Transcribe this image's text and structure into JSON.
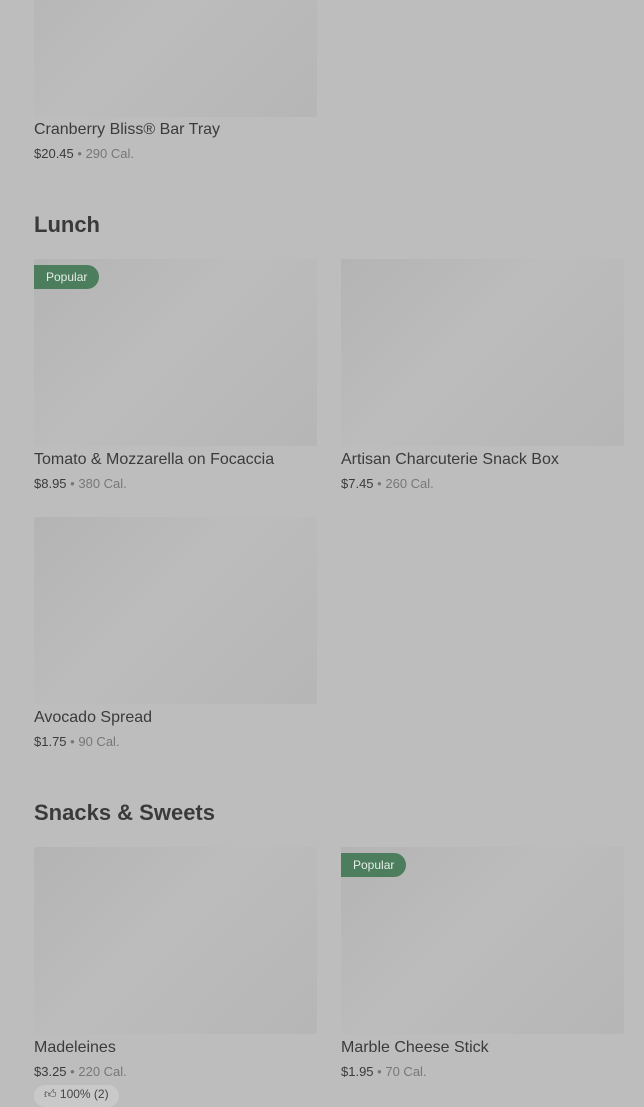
{
  "items": {
    "cranberry": {
      "name": "Cranberry Bliss® Bar Tray",
      "price": "$20.45",
      "cal": "290 Cal."
    },
    "tomato": {
      "name": "Tomato & Mozzarella on Focaccia",
      "price": "$8.95",
      "cal": "380 Cal.",
      "badge": "Popular"
    },
    "charcuterie": {
      "name": "Artisan Charcuterie Snack Box",
      "price": "$7.45",
      "cal": "260 Cal."
    },
    "avocado": {
      "name": "Avocado Spread",
      "price": "$1.75",
      "cal": "90 Cal."
    },
    "madeleines": {
      "name": "Madeleines",
      "price": "$3.25",
      "cal": "220 Cal.",
      "rating": "100% (2)"
    },
    "marble": {
      "name": "Marble Cheese Stick",
      "price": "$1.95",
      "cal": "70 Cal.",
      "badge": "Popular"
    }
  },
  "sections": {
    "lunch": "Lunch",
    "snacks": "Snacks & Sweets"
  },
  "separator": "•",
  "icons": {
    "rating": "thumbs-up-icon"
  },
  "colors": {
    "badge": "#4c7d5d",
    "background": "#bdbdbd"
  }
}
